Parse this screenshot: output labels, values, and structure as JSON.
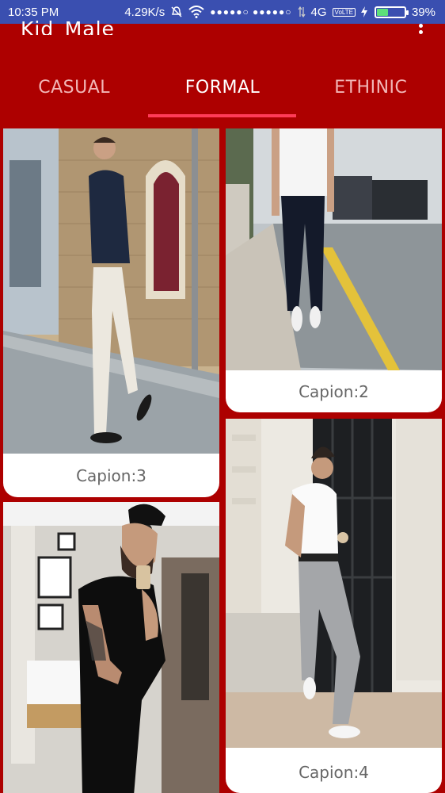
{
  "status_bar": {
    "time": "10:35 PM",
    "speed": "4.29K/s",
    "network": "4G",
    "volte": "VoLTE",
    "battery": "39%",
    "battery_level": 0.39,
    "signal_dots": "●●●●●○ ●●●●●○"
  },
  "app": {
    "title": "Kid_Male"
  },
  "tabs": [
    {
      "label": "CASUAL",
      "active": false
    },
    {
      "label": "FORMAL",
      "active": true
    },
    {
      "label": "ETHINIC",
      "active": false
    }
  ],
  "cards": [
    {
      "caption": "Capion:3",
      "photo": "man in dark shirt and white trousers on street"
    },
    {
      "caption": "Capion:2",
      "photo": "man in white tee and dark jeans walking"
    },
    {
      "caption": "",
      "photo": "man taking mirror selfie in bedroom"
    },
    {
      "caption": "Capion:4",
      "photo": "man in white shirt leaning on wall"
    }
  ],
  "colors": {
    "primary": "#ad0000",
    "status_bar": "#3a4fb0",
    "tab_indicator": "#ff3b58"
  }
}
